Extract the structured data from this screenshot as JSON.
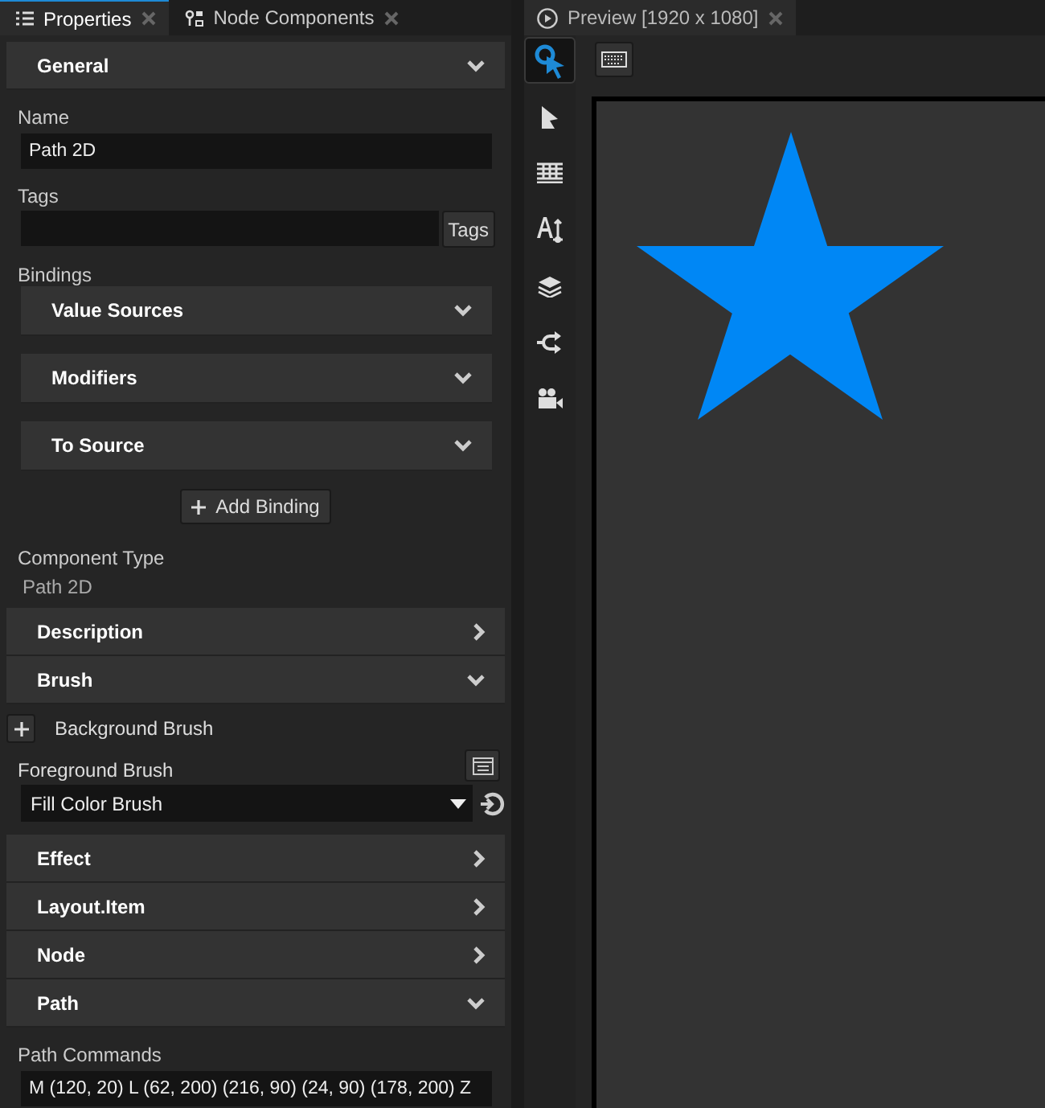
{
  "left_tabs": [
    {
      "label": "Properties",
      "selected": true
    },
    {
      "label": "Node Components",
      "selected": false
    }
  ],
  "properties": [
    {
      "kind": "section",
      "title": "General",
      "expanded": true
    },
    {
      "kind": "label",
      "text": "Name"
    },
    {
      "kind": "field",
      "value": "Path 2D"
    },
    {
      "kind": "label",
      "text": "Tags"
    },
    {
      "kind": "tagfield",
      "button": "Tags"
    },
    {
      "kind": "label",
      "text": "Bindings"
    },
    {
      "kind": "subsection",
      "title": "Value Sources",
      "expanded": true
    },
    {
      "kind": "subsection",
      "title": "Modifiers",
      "expanded": true
    },
    {
      "kind": "subsection",
      "title": "To Source",
      "expanded": true
    },
    {
      "kind": "addbutton",
      "text": "Add Binding"
    },
    {
      "kind": "label",
      "text": "Component Type"
    },
    {
      "kind": "value",
      "text": "Path 2D"
    },
    {
      "kind": "section",
      "title": "Description",
      "expanded": false
    },
    {
      "kind": "section",
      "title": "Brush",
      "expanded": true
    },
    {
      "kind": "addrow",
      "text": "Background Brush"
    },
    {
      "kind": "labelbtn",
      "text": "Foreground Brush"
    },
    {
      "kind": "dropdown",
      "value": "Fill Color Brush"
    },
    {
      "kind": "section",
      "title": "Effect",
      "expanded": false
    },
    {
      "kind": "section",
      "title": "Layout.Item",
      "expanded": false
    },
    {
      "kind": "section",
      "title": "Node",
      "expanded": false
    },
    {
      "kind": "section",
      "title": "Path",
      "expanded": true
    },
    {
      "kind": "label",
      "text": "Path Commands"
    },
    {
      "kind": "field",
      "value": "M (120, 20) L (62, 200) (216, 90) (24, 90) (178, 200) Z"
    }
  ],
  "preview": {
    "tab": {
      "label": "Preview [1920 x 1080]",
      "selected": true
    },
    "tools": [
      {
        "selected": true
      },
      {
        "selected": false
      },
      {
        "selected": false
      },
      {
        "selected": false
      },
      {
        "selected": false
      },
      {
        "selected": false
      },
      {
        "selected": false
      }
    ]
  }
}
